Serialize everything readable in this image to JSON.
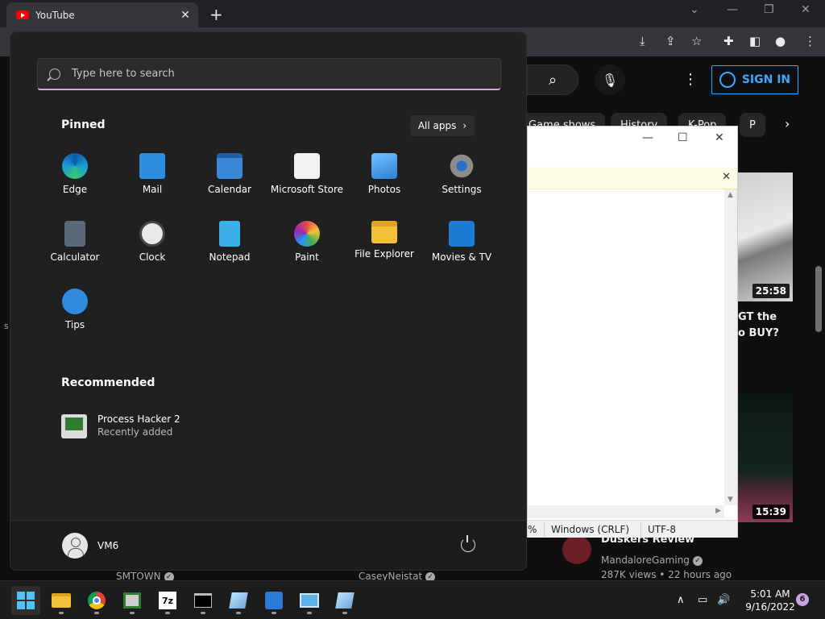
{
  "browser": {
    "tab_title": "YouTube",
    "tab_close": "✕",
    "new_tab": "+"
  },
  "youtube": {
    "sign_in": "SIGN IN",
    "chips": [
      "Game shows",
      "History",
      "K-Pop",
      "P"
    ],
    "video1": {
      "duration": "25:58",
      "title_line1": "GT the",
      "title_line2": "o BUY?"
    },
    "video2": {
      "duration": "15:39"
    },
    "row": {
      "title": "Duskers Review",
      "channel": "MandaloreGaming",
      "meta": "287K views • 22 hours ago"
    },
    "channels": [
      "SMTOWN",
      "CaseyNeistat"
    ],
    "side_letter": "s"
  },
  "notepad": {
    "status": {
      "zoom": "%",
      "line_ending": "Windows (CRLF)",
      "encoding": "UTF-8"
    }
  },
  "start_menu": {
    "search_placeholder": "Type here to search",
    "pinned_title": "Pinned",
    "all_apps": "All apps",
    "pinned": [
      {
        "label": "Edge",
        "icon": "edge-icon",
        "color": "#1a9bd8"
      },
      {
        "label": "Mail",
        "icon": "mail-icon",
        "color": "#2c8de0"
      },
      {
        "label": "Calendar",
        "icon": "calendar-icon",
        "color": "#3a87d6"
      },
      {
        "label": "Microsoft Store",
        "icon": "store-icon",
        "color": "#f2f2f2"
      },
      {
        "label": "Photos",
        "icon": "photos-icon",
        "color": "#2f7fd3"
      },
      {
        "label": "Settings",
        "icon": "settings-gear-icon",
        "color": "#8c8c8c"
      },
      {
        "label": "Calculator",
        "icon": "calculator-icon",
        "color": "#5a6a7a"
      },
      {
        "label": "Clock",
        "icon": "clock-icon",
        "color": "#e8e8e8"
      },
      {
        "label": "Notepad",
        "icon": "notepad-icon",
        "color": "#3ab0e6"
      },
      {
        "label": "Paint",
        "icon": "paint-icon",
        "color": "#4ca3dd"
      },
      {
        "label": "File Explorer",
        "icon": "folder-icon",
        "color": "#f4c237"
      },
      {
        "label": "Movies & TV",
        "icon": "movies-icon",
        "color": "#1c7bd4"
      },
      {
        "label": "Tips",
        "icon": "tips-icon",
        "color": "#2f8be0"
      }
    ],
    "recommended_title": "Recommended",
    "recommended": [
      {
        "title": "Process Hacker 2",
        "subtitle": "Recently added"
      }
    ],
    "user": "VM6"
  },
  "taskbar": {
    "time": "5:01 AM",
    "date": "9/16/2022",
    "notifications": "6"
  }
}
